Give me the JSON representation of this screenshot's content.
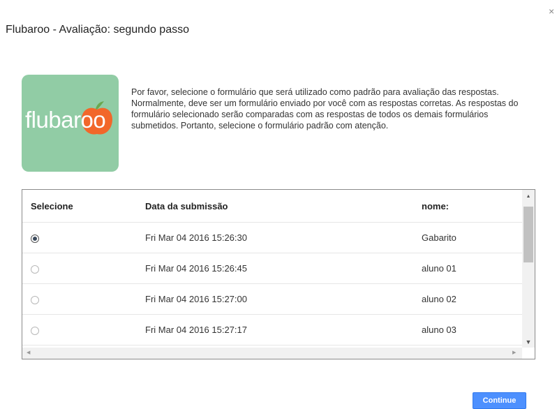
{
  "dialog": {
    "title": "Flubaroo - Avaliação: segundo passo",
    "close_glyph": "×"
  },
  "logo": {
    "text_before": "fluba",
    "text_apple": "roo"
  },
  "description": "Por favor, selecione o formulário que será utilizado como padrão para avaliação das respostas. Normalmente, deve ser um formulário enviado por você com as respostas corretas. As respostas do formulário selecionado serão comparadas com as respostas de todos os demais formulários submetidos. Portanto, selecione o formulário padrão com atenção.",
  "table": {
    "headers": [
      "Selecione",
      "Data da submissão",
      "nome:"
    ],
    "rows": [
      {
        "selected": true,
        "date": "Fri Mar 04 2016 15:26:30",
        "name": "Gabarito"
      },
      {
        "selected": false,
        "date": "Fri Mar 04 2016 15:26:45",
        "name": "aluno 01"
      },
      {
        "selected": false,
        "date": "Fri Mar 04 2016 15:27:00",
        "name": "aluno 02"
      },
      {
        "selected": false,
        "date": "Fri Mar 04 2016 15:27:17",
        "name": "aluno 03"
      }
    ]
  },
  "buttons": {
    "continue": "Continue"
  },
  "colors": {
    "logo_bg": "#91cca5",
    "apple": "#f2672a",
    "button": "#4d90fe"
  },
  "icons": {
    "close": "close-icon",
    "logo": "flubaroo-logo",
    "apple": "apple-icon"
  }
}
